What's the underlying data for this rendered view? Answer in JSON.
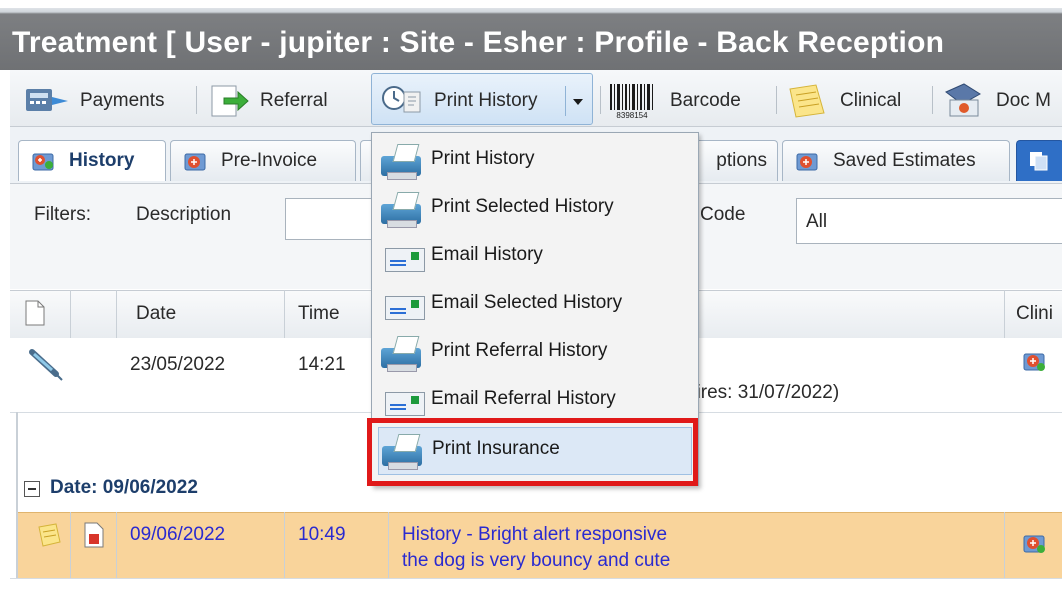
{
  "window": {
    "title": "Treatment [ User - jupiter : Site - Esher : Profile - Back Reception"
  },
  "toolbar": {
    "payments_label": "Payments",
    "referral_label": "Referral",
    "print_history_label": "Print History",
    "barcode_label": "Barcode",
    "barcode_digits": "8398154",
    "clinical_label": "Clinical",
    "doc_label": "Doc M"
  },
  "tabs": {
    "history": "History",
    "pre_invoice": "Pre-Invoice",
    "options_partial": "ptions",
    "saved_estimates": "Saved Estimates"
  },
  "filters": {
    "filters_label": "Filters:",
    "description_label": "Description",
    "code_label": "Code",
    "code_value": "All"
  },
  "grid": {
    "headers": {
      "date": "Date",
      "time": "Time",
      "clinic_partial": "Clini"
    },
    "row1": {
      "date": "23/05/2022",
      "time": "14:21",
      "desc_partial": "pires: 31/07/2022)"
    },
    "group_label": "Date: 09/06/2022",
    "row2": {
      "date": "09/06/2022",
      "time": "10:49",
      "desc_line1": "History - Bright alert responsive",
      "desc_line2": "the dog is very bouncy and cute"
    }
  },
  "dropdown": {
    "items": [
      {
        "label": "Print History",
        "icon": "printer-icon"
      },
      {
        "label": "Print Selected History",
        "icon": "printer-icon"
      },
      {
        "label": "Email History",
        "icon": "email-icon"
      },
      {
        "label": "Email Selected History",
        "icon": "email-icon"
      },
      {
        "label": "Print Referral History",
        "icon": "printer-icon"
      },
      {
        "label": "Email Referral History",
        "icon": "email-icon"
      },
      {
        "label": "Print Insurance",
        "icon": "printer-icon"
      }
    ],
    "highlighted": "Print Insurance"
  },
  "colors": {
    "highlight_row": "#f9d49b",
    "callout_border": "#e01919",
    "link_blue": "#2a2ad0"
  }
}
